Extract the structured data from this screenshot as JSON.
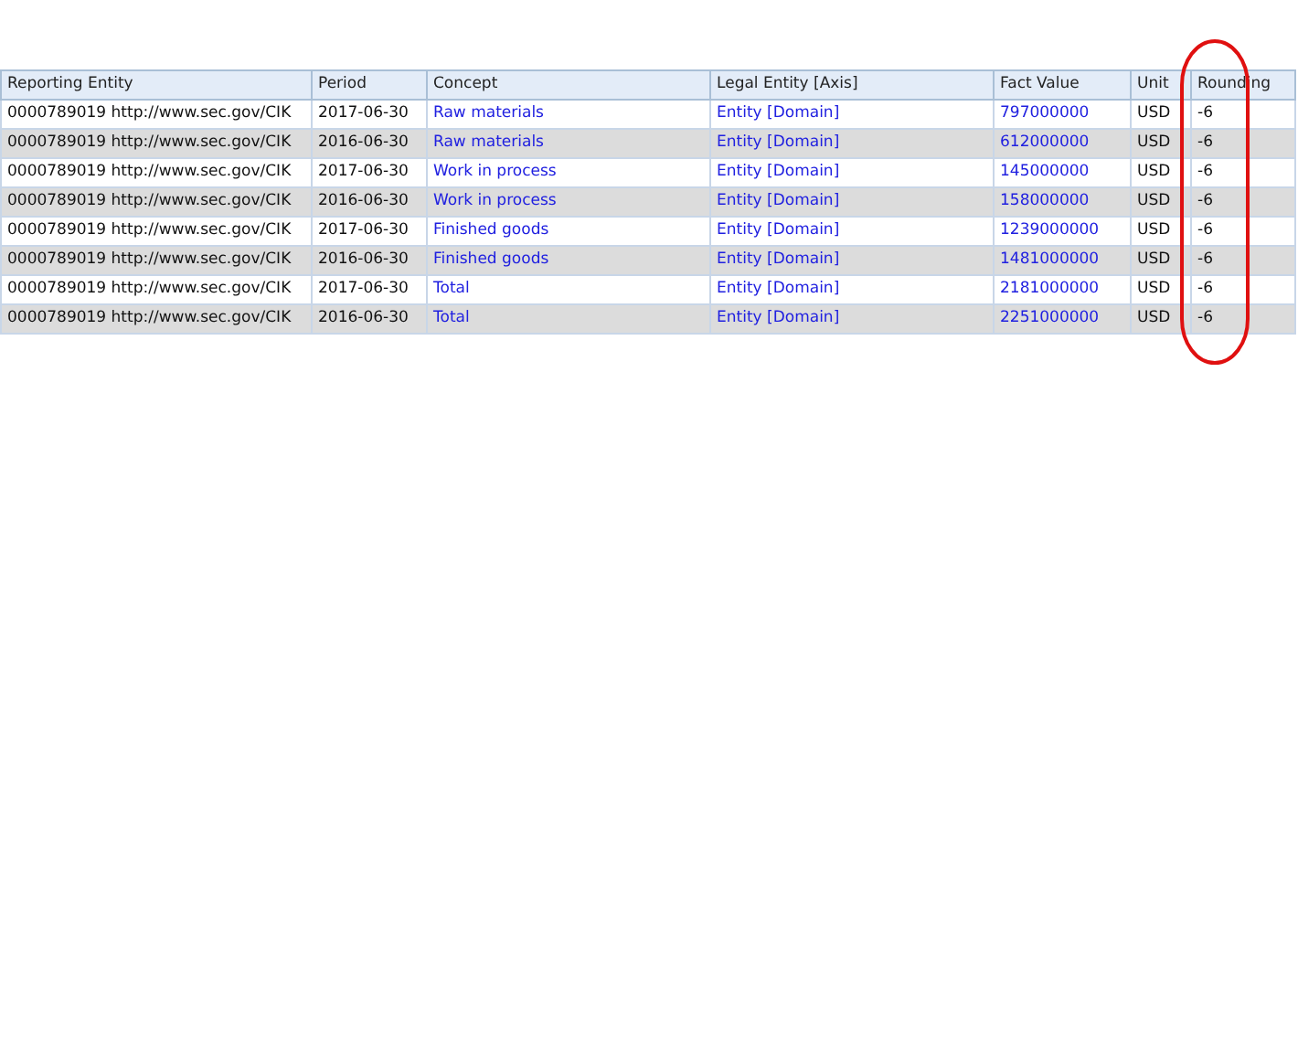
{
  "table": {
    "columns": [
      "Reporting Entity",
      "Period",
      "Concept",
      "Legal Entity [Axis]",
      "Fact Value",
      "Unit",
      "Rounding"
    ],
    "rows": [
      [
        "0000789019 http://www.sec.gov/CIK",
        "2017-06-30",
        "Raw materials",
        "Entity [Domain]",
        "797000000",
        "USD",
        "-6"
      ],
      [
        "0000789019 http://www.sec.gov/CIK",
        "2016-06-30",
        "Raw materials",
        "Entity [Domain]",
        "612000000",
        "USD",
        "-6"
      ],
      [
        "0000789019 http://www.sec.gov/CIK",
        "2017-06-30",
        "Work in process",
        "Entity [Domain]",
        "145000000",
        "USD",
        "-6"
      ],
      [
        "0000789019 http://www.sec.gov/CIK",
        "2016-06-30",
        "Work in process",
        "Entity [Domain]",
        "158000000",
        "USD",
        "-6"
      ],
      [
        "0000789019 http://www.sec.gov/CIK",
        "2017-06-30",
        "Finished goods",
        "Entity [Domain]",
        "1239000000",
        "USD",
        "-6"
      ],
      [
        "0000789019 http://www.sec.gov/CIK",
        "2016-06-30",
        "Finished goods",
        "Entity [Domain]",
        "1481000000",
        "USD",
        "-6"
      ],
      [
        "0000789019 http://www.sec.gov/CIK",
        "2017-06-30",
        "Total",
        "Entity [Domain]",
        "2181000000",
        "USD",
        "-6"
      ],
      [
        "0000789019 http://www.sec.gov/CIK",
        "2016-06-30",
        "Total",
        "Entity [Domain]",
        "2251000000",
        "USD",
        "-6"
      ]
    ]
  }
}
